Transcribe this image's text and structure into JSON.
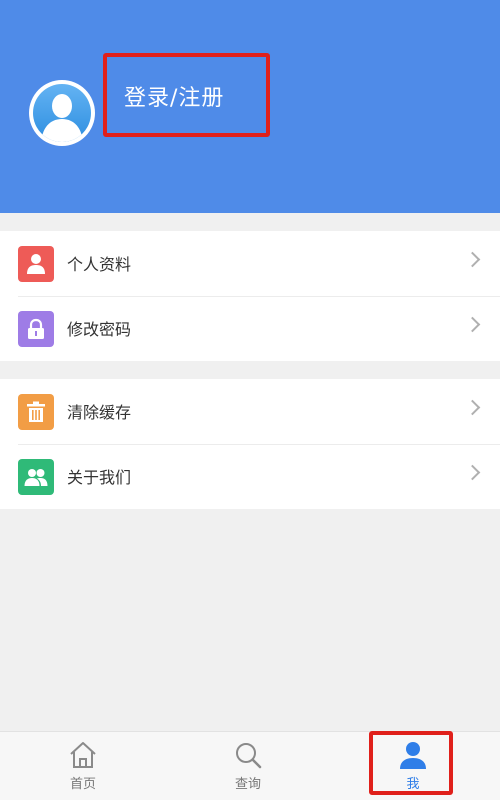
{
  "profile": {
    "login_label": "登录/注册"
  },
  "menu": {
    "group1": [
      {
        "label": "个人资料",
        "icon": "person-icon",
        "color": "#ee5b57"
      },
      {
        "label": "修改密码",
        "icon": "lock-icon",
        "color": "#9e7ce6"
      }
    ],
    "group2": [
      {
        "label": "清除缓存",
        "icon": "trash-icon",
        "color": "#f29d45"
      },
      {
        "label": "关于我们",
        "icon": "group-icon",
        "color": "#2fba78"
      }
    ]
  },
  "tabs": [
    {
      "label": "首页",
      "icon": "home-icon"
    },
    {
      "label": "查询",
      "icon": "search-icon"
    },
    {
      "label": "我",
      "icon": "user-icon",
      "active": true
    }
  ],
  "colors": {
    "header": "#4f8be8",
    "accent": "#2f7ee8",
    "highlight_box": "#e0201b"
  }
}
